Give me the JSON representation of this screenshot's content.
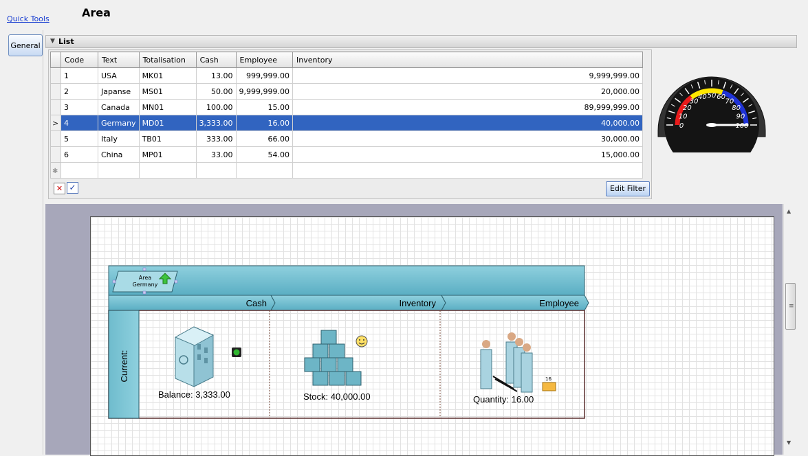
{
  "header": {
    "quick_tools": "Quick Tools",
    "title": "Area"
  },
  "tabs": {
    "general": "General"
  },
  "list": {
    "title": "List",
    "columns": [
      "Code",
      "Text",
      "Totalisation",
      "Cash",
      "Employee",
      "Inventory"
    ],
    "rows": [
      [
        "1",
        "USA",
        "MK01",
        "13.00",
        "999,999.00",
        "9,999,999.00"
      ],
      [
        "2",
        "Japanse",
        "MS01",
        "50.00",
        "9,999,999.00",
        "20,000.00"
      ],
      [
        "3",
        "Canada",
        "MN01",
        "100.00",
        "15.00",
        "89,999,999.00"
      ],
      [
        "4",
        "Germany",
        "MD01",
        "3,333.00",
        "16.00",
        "40,000.00"
      ],
      [
        "5",
        "Italy",
        "TB01",
        "333.00",
        "66.00",
        "30,000.00"
      ],
      [
        "6",
        "China",
        "MP01",
        "33.00",
        "54.00",
        "15,000.00"
      ]
    ],
    "selected_row_index": 3,
    "edit_filter": "Edit Filter"
  },
  "gauge": {
    "ticks": [
      "0",
      "10",
      "20",
      "30",
      "40",
      "50",
      "60",
      "70",
      "80",
      "90",
      "100"
    ],
    "needle_value": 100,
    "colors": {
      "red": "#e81b1b",
      "yellow": "#ffe600",
      "blue": "#1f33d6"
    }
  },
  "diagram": {
    "area_label_line1": "Area",
    "area_label_line2": "Germany",
    "columns": [
      "Cash",
      "Inventory",
      "Employee"
    ],
    "row_label": "Current:",
    "balance": "Balance: 3,333.00",
    "stock": "Stock: 40,000.00",
    "quantity": "Quantity: 16.00",
    "badge": "16",
    "colors": {
      "lane_header": "#74c0d1",
      "status_green": "#2fb52f",
      "arrow_green": "#3ec43e",
      "smiley": "#ffe066"
    }
  }
}
